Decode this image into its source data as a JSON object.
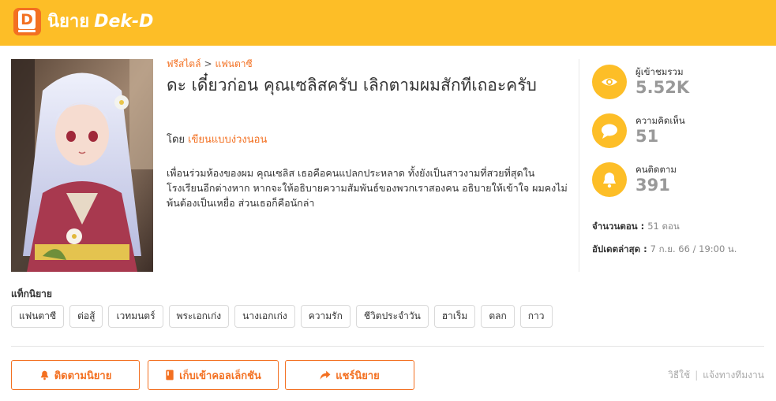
{
  "header": {
    "logo_letter": "D",
    "site_name": "นิยาย",
    "brand": "Dek-D"
  },
  "breadcrumb": {
    "genre": "ฟรีสไตล์",
    "separator": ">",
    "subgenre": "แฟนตาซี"
  },
  "novel": {
    "title": "ดะ เดี๋ยวก่อน คุณเซลิสครับ เลิกตามผมสักทีเถอะครับ",
    "by_label": "โดย",
    "author": "เขียนแบบง่วงนอน",
    "description": "เพื่อนร่วมห้องของผม คุณเซลิส เธอคือคนแปลกประหลาด ทั้งยังเป็นสาวงามที่สวยที่สุดในโรงเรียนอีกต่างหาก หากจะให้อธิบายความสัมพันธ์ของพวกเราสองคน อธิบายให้เข้าใจ ผมคงไม่พ้นต้องเป็นเหยื่อ ส่วนเธอก็คือนักล่า"
  },
  "stats": [
    {
      "icon": "eye-icon",
      "label": "ผู้เข้าชมรวม",
      "value": "5.52K"
    },
    {
      "icon": "comment-icon",
      "label": "ความคิดเห็น",
      "value": "51"
    },
    {
      "icon": "bell-icon",
      "label": "คนติดตาม",
      "value": "391"
    }
  ],
  "meta": {
    "chapters_label": "จำนวนตอน :",
    "chapters_value": "51 ตอน",
    "updated_label": "อัปเดตล่าสุด :",
    "updated_value": "7 ก.ย. 66 / 19:00 น."
  },
  "tags": {
    "heading": "แท็กนิยาย",
    "items": [
      "แฟนตาซี",
      "ต่อสู้",
      "เวทมนตร์",
      "พระเอกเก่ง",
      "นางเอกเก่ง",
      "ความรัก",
      "ชีวิตประจำวัน",
      "ฮาเร็ม",
      "ตลก",
      "กาว"
    ]
  },
  "actions": {
    "follow": "ติดตามนิยาย",
    "collect": "เก็บเข้าคอลเล็กชัน",
    "share": "แชร์นิยาย"
  },
  "footer": {
    "howto": "วิธีใช้",
    "separator": "|",
    "report": "แจ้งทางทีมงาน"
  },
  "colors": {
    "header": "#fdbe27",
    "accent": "#f37021",
    "stat_value": "#999999"
  }
}
